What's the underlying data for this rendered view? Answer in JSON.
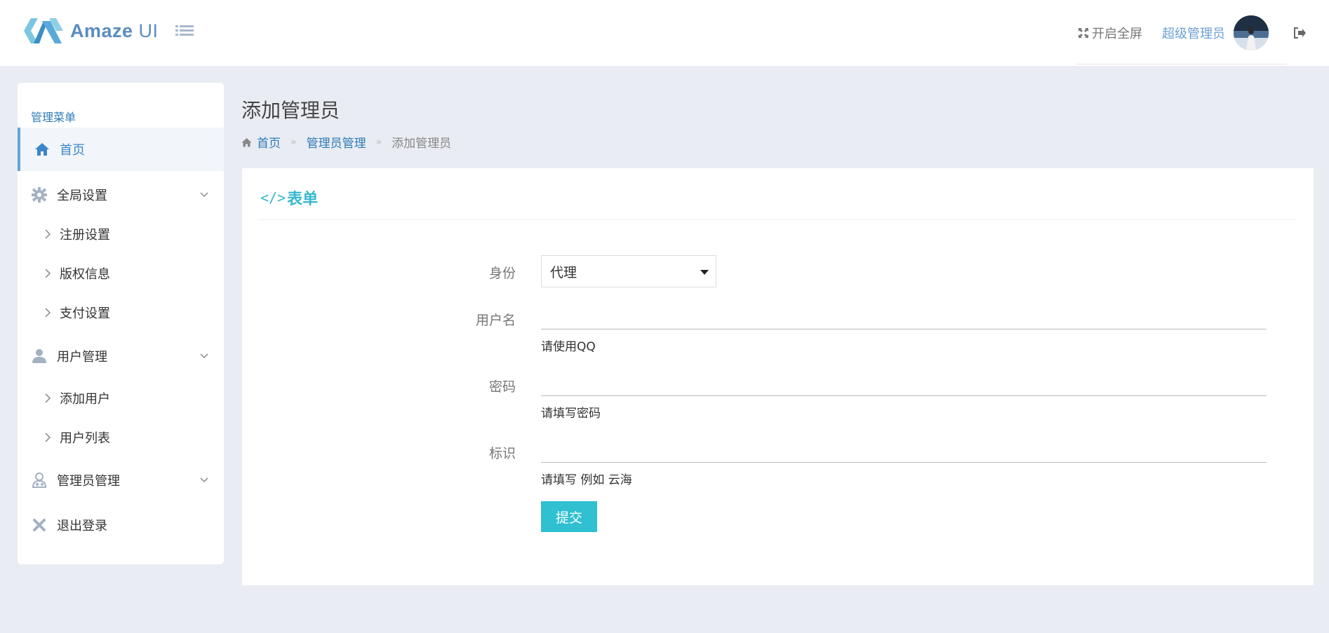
{
  "header": {
    "brand": "Amaze",
    "brand_suffix": " UI",
    "fullscreen_label": "开启全屏",
    "user_name": "超级管理员"
  },
  "sidebar": {
    "title": "管理菜单",
    "items": [
      {
        "label": "首页",
        "icon": "home-icon",
        "active": true
      },
      {
        "label": "全局设置",
        "icon": "gear-icon",
        "expandable": true,
        "children": [
          {
            "label": "注册设置"
          },
          {
            "label": "版权信息"
          },
          {
            "label": "支付设置"
          }
        ]
      },
      {
        "label": "用户管理",
        "icon": "user-icon",
        "expandable": true,
        "children": [
          {
            "label": "添加用户"
          },
          {
            "label": "用户列表"
          }
        ]
      },
      {
        "label": "管理员管理",
        "icon": "admin-icon",
        "expandable": true
      },
      {
        "label": "退出登录",
        "icon": "close-icon"
      }
    ]
  },
  "page": {
    "title": "添加管理员",
    "breadcrumb": [
      "首页",
      "管理员管理",
      "添加管理员"
    ]
  },
  "panel": {
    "title": "表单",
    "title_prefix": "</>"
  },
  "form": {
    "role": {
      "label": "身份",
      "selected": "代理"
    },
    "username": {
      "label": "用户名",
      "value": "",
      "help": "请使用QQ"
    },
    "password": {
      "label": "密码",
      "value": "",
      "help": "请填写密码"
    },
    "tag": {
      "label": "标识",
      "value": "",
      "help": "请填写 例如 云海"
    },
    "submit_label": "提交"
  },
  "colors": {
    "accent": "#2fc0d1",
    "link": "#2e7bb8",
    "background": "#e9ecf3"
  }
}
